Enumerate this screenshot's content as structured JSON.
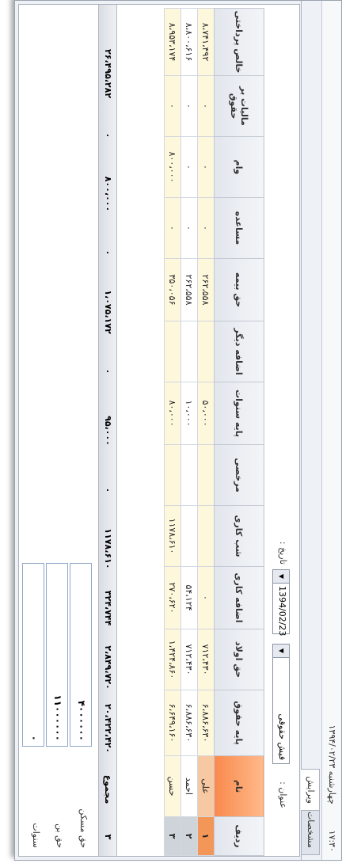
{
  "titlebar": {
    "clock": "۱۷:۳۰",
    "date": "چهارشنبه ۱۳۹۴/۰۲/۲۳"
  },
  "tabs": [
    {
      "label": "مشخصات"
    },
    {
      "label": "ویرایش"
    }
  ],
  "form": {
    "title_label": "عنوان :",
    "title_value": "فیش حقوقی",
    "date_label": "تاریخ :",
    "date_value": "1394/02/23"
  },
  "table": {
    "columns": [
      "ردیف",
      "نام",
      "پایه حقوق",
      "حق اولاد",
      "اضافه کاری",
      "شب کاری",
      "مرخصی",
      "پایه سنوات",
      "اضافه دیگر",
      "حق بیمه",
      "مساعده",
      "وام",
      "مالیات بر حقوق",
      "خالص پرداختی"
    ],
    "rows": [
      [
        "۱",
        "علی",
        "۶،۸۸۶،۶۳۰",
        "۷۱۲،۴۳۰",
        "۰",
        "",
        "",
        "۵۰،۰۰۰",
        "",
        "۲۶۲،۵۵۸",
        "۰",
        "۰",
        "۰",
        "۸،۷۴۱،۴۹۲"
      ],
      [
        "۲",
        "احمد",
        "۶،۸۸۶،۶۳۰",
        "۷۱۲،۴۳۰",
        "۵۴،۱۲۴",
        "",
        "",
        "۱۰،۰۰۰",
        "",
        "۲۶۲،۵۵۸",
        "۰",
        "۰",
        "۰",
        "۸،۸۰۰،۶۱۶"
      ],
      [
        "۳",
        "حسن",
        "۶،۶۴۹،۱۶۰",
        "۱،۴۲۴،۸۶۰",
        "۲۷۰،۶۲۰",
        "۱۱۷۸،۶۱۰",
        "",
        "۸۰،۰۰۰",
        "",
        "۳۵۰،۰۵۶",
        "۰",
        "۸۰۰،۰۰۰",
        "۰",
        "۸،۹۵۳،۱۷۴"
      ]
    ],
    "totals": {
      "count": "۳",
      "label": "مجموع",
      "base": "۲۰،۴۲۲،۴۲۰",
      "children": "۲،۸۴۹،۷۲۰",
      "overtime": "۳۲۴،۷۴۴",
      "night": "۱۱۷۸،۶۱۰",
      "leave": "۰",
      "seniority": "۹۵،۰۰۰",
      "other": "۰",
      "insurance": "۱،۰۷۵،۱۷۲",
      "advance": "۰",
      "loan": "۸۰۰،۰۰۰",
      "tax": "۰",
      "net": "۲۶،۴۹۵،۲۸۲"
    }
  },
  "footer": {
    "housing_label": "حق مسکن",
    "housing_value": "۴۰۰۰۰۰۰",
    "food_label": "حق بن",
    "food_value": "۱۱۰۰۰۰۰۰",
    "seniority_label": "سنوات",
    "seniority_value": "۰"
  }
}
